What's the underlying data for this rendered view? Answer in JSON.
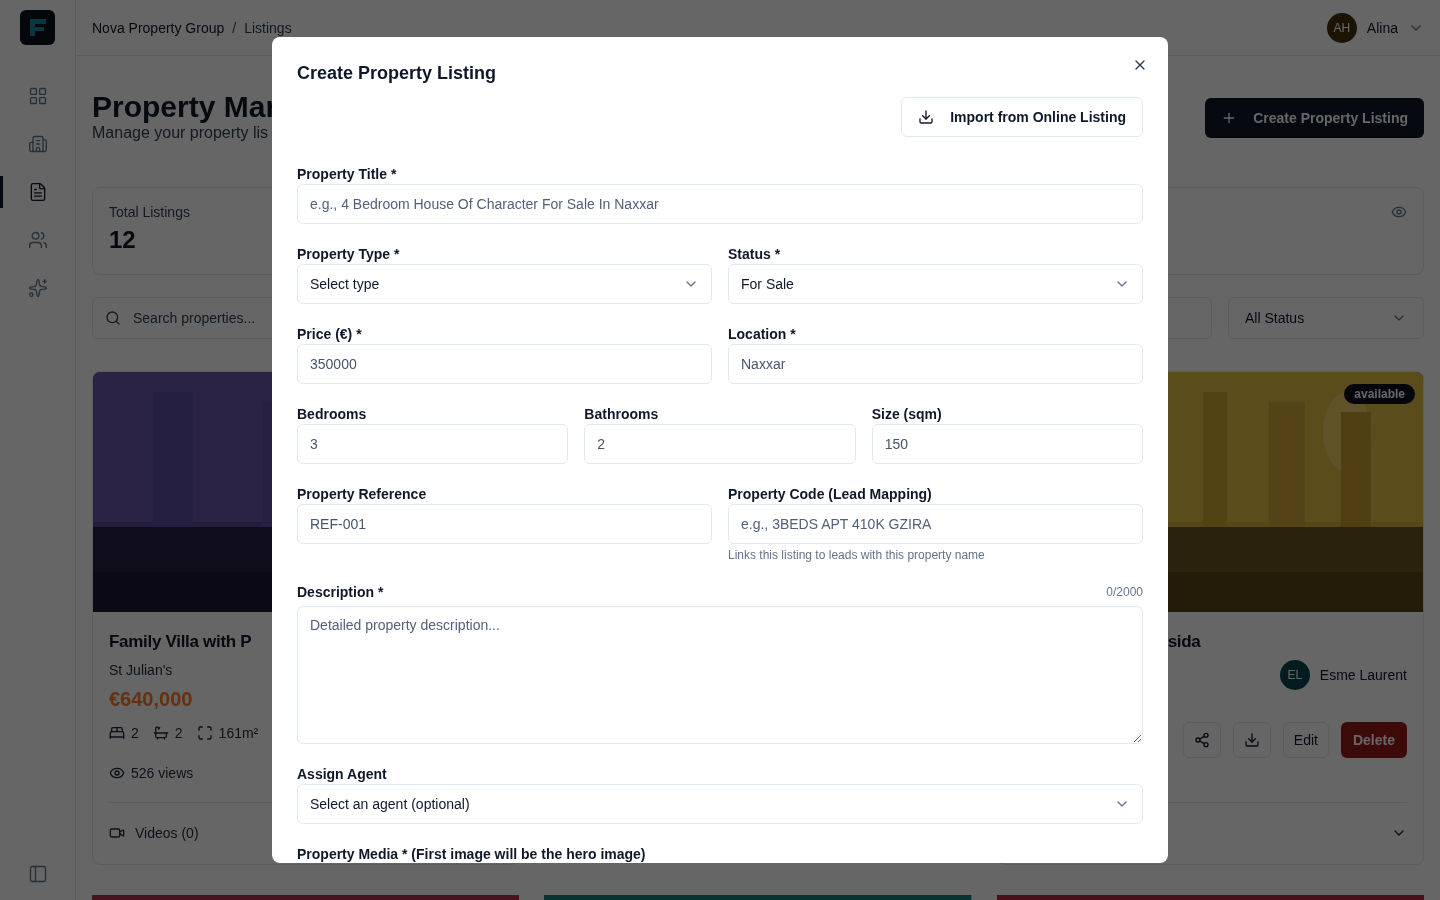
{
  "sidebar": {
    "items": [
      {
        "selected": false
      },
      {
        "selected": false
      },
      {
        "selected": true
      },
      {
        "selected": false
      },
      {
        "selected": false
      }
    ]
  },
  "header": {
    "breadcrumb": [
      "Nova Property Group",
      "Listings"
    ],
    "separator": "/",
    "user": {
      "initials": "AH",
      "name": "Alina"
    }
  },
  "page": {
    "title": "Property Mar",
    "subtitle": "Manage your property lis",
    "create_button": "Create Property Listing"
  },
  "stats": [
    {
      "label": "Total Listings",
      "value": "12"
    }
  ],
  "filters": {
    "search_placeholder": "Search properties...",
    "status": "All Status"
  },
  "listings": [
    {
      "title": "Family Villa with P",
      "location": "St Julian's",
      "price": "€640,000",
      "beds": "2",
      "baths": "2",
      "size": "161m²",
      "views": "526 views",
      "videos": "Videos (0)"
    },
    {
      "title": "sida",
      "badge": "available",
      "agent": {
        "initials": "EL",
        "name": "Esme Laurent"
      },
      "edit": "Edit",
      "delete": "Delete"
    }
  ],
  "modal": {
    "title": "Create Property Listing",
    "import_button": "Import from Online Listing",
    "rows": [
      [
        {
          "kind": "input",
          "label": "Property Title *",
          "placeholder": "e.g., 4 Bedroom House Of Character For Sale In Naxxar"
        }
      ],
      [
        {
          "kind": "select",
          "label": "Property Type *",
          "value": "Select type"
        },
        {
          "kind": "select",
          "label": "Status *",
          "value": "For Sale"
        }
      ],
      [
        {
          "kind": "input",
          "label": "Price (€) *",
          "value": "350000"
        },
        {
          "kind": "input",
          "label": "Location *",
          "value": "Naxxar"
        }
      ],
      [
        {
          "kind": "input",
          "label": "Bedrooms",
          "value": "3"
        },
        {
          "kind": "input",
          "label": "Bathrooms",
          "value": "2"
        },
        {
          "kind": "input",
          "label": "Size (sqm)",
          "value": "150"
        }
      ],
      [
        {
          "kind": "input",
          "label": "Property Reference",
          "value": "REF-001"
        },
        {
          "kind": "input",
          "label": "Property Code (Lead Mapping)",
          "placeholder": "e.g., 3BEDS APT 410K GZIRA",
          "hint": "Links this listing to leads with this property name"
        }
      ],
      [
        {
          "kind": "textarea",
          "label": "Description *",
          "counter": "0/2000",
          "placeholder": "Detailed property description..."
        }
      ],
      [
        {
          "kind": "select",
          "label": "Assign Agent",
          "value": "Select an agent (optional)"
        }
      ],
      [
        {
          "kind": "heading",
          "label": "Property Media * (First image will be the hero image)"
        }
      ]
    ]
  }
}
